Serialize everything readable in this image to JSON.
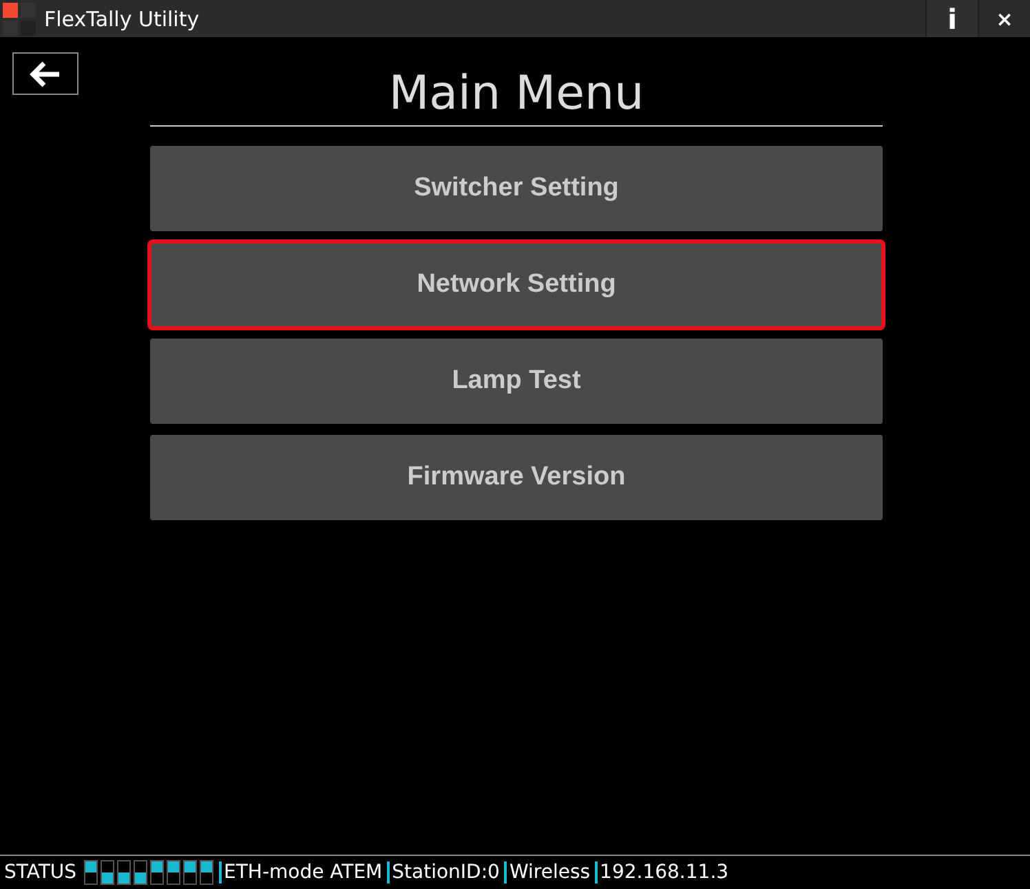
{
  "window": {
    "title": "FlexTally Utility",
    "buttons": [
      {
        "kind": "info",
        "label": "i"
      },
      {
        "kind": "close",
        "label": "×"
      }
    ]
  },
  "heading": "Main Menu",
  "menu": [
    {
      "label": "Switcher Setting",
      "selected": false
    },
    {
      "label": "Network Setting",
      "selected": true
    },
    {
      "label": "Lamp Test",
      "selected": false
    },
    {
      "label": "Firmware Version",
      "selected": false
    }
  ],
  "status_bar": {
    "label": "STATUS",
    "indicators": [
      {
        "kind": "top"
      },
      {
        "kind": "bottom"
      },
      {
        "kind": "bottom"
      },
      {
        "kind": "bottom"
      },
      {
        "kind": "top"
      },
      {
        "kind": "top"
      },
      {
        "kind": "top"
      },
      {
        "kind": "top"
      }
    ],
    "fields": [
      "ETH-mode ATEM",
      "StationID:0",
      "Wireless",
      "192.168.11.3"
    ]
  }
}
